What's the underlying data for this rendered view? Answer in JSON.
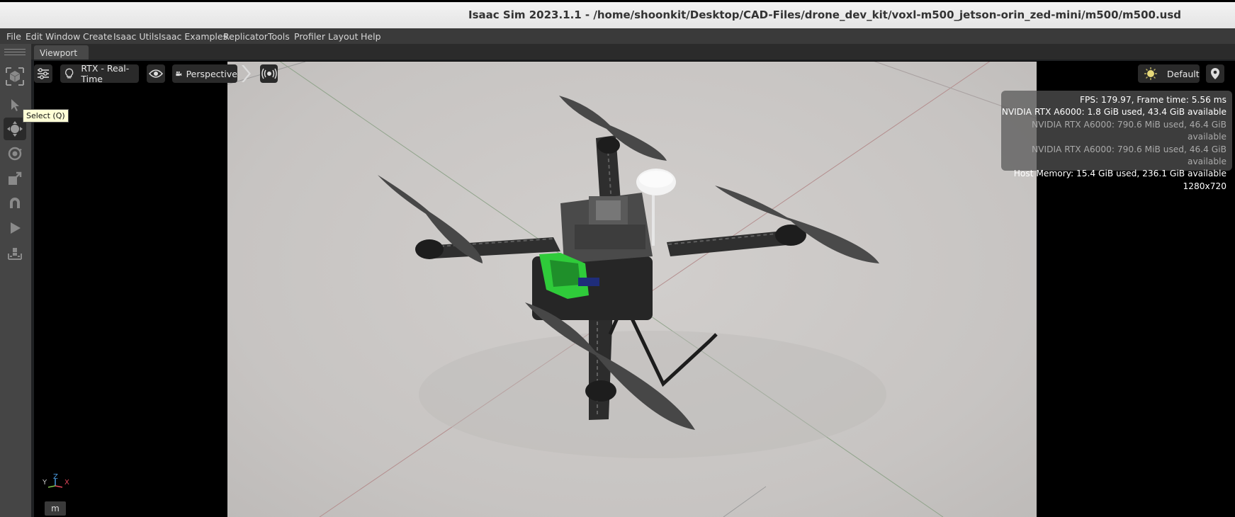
{
  "window": {
    "title": "Isaac Sim 2023.1.1 - /home/shoonkit/Desktop/CAD-Files/drone_dev_kit/voxl-m500_jetson-orin_zed-mini/m500/m500.usd"
  },
  "menu": [
    "File",
    "Edit",
    "Window",
    "Create",
    "Isaac Utils",
    "Isaac Examples",
    "Replicator",
    "Tools",
    "Profiler",
    "Layout",
    "Help"
  ],
  "left_toolbar": {
    "tools": [
      "cube-icon",
      "select-arrow-icon",
      "move-icon",
      "rotate-icon",
      "scale-icon",
      "snap-magnet-icon",
      "play-icon",
      "build-icon"
    ],
    "tooltip": "Select (Q)"
  },
  "tab": {
    "label": "Viewport"
  },
  "viewport": {
    "settings_icon": "sliders-icon",
    "render_mode": "RTX - Real-Time",
    "camera": "Perspective",
    "lighting": "Default",
    "stats": [
      "FPS: 179.97, Frame time: 5.56 ms",
      "NVIDIA RTX A6000: 1.8 GiB used, 43.4 GiB available",
      "NVIDIA RTX A6000: 790.6 MiB used, 46.4 GiB available",
      "NVIDIA RTX A6000: 790.6 MiB used, 46.4 GiB available",
      "Host Memory: 15.4 GiB used, 236.1 GiB available",
      "1280x720"
    ],
    "axis": {
      "y": "Y",
      "z": "Z",
      "x": "X"
    },
    "unit": "m"
  },
  "colors": {
    "x_axis": "#e0455a",
    "y_axis": "#7fc24a",
    "z_axis": "#4a9ae0",
    "pcb_green": "#2fcb3a"
  }
}
